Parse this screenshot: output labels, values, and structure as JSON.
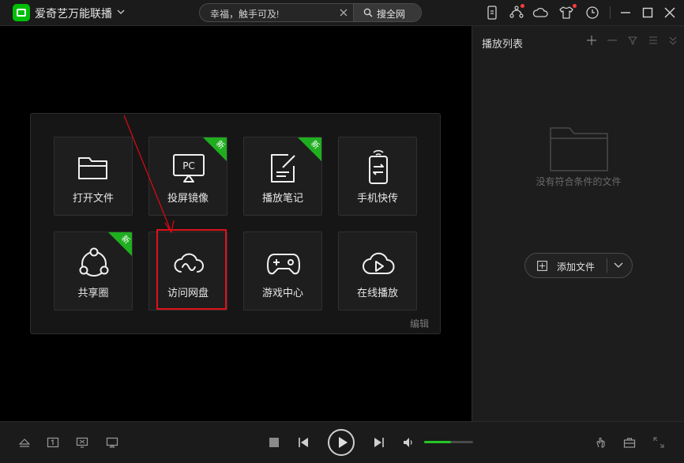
{
  "app": {
    "title": "爱奇艺万能联播"
  },
  "search": {
    "placeholder": "幸福，触手可及!",
    "button_label": "搜全网"
  },
  "playlist": {
    "title": "播放列表",
    "empty_text": "没有符合条件的文件",
    "add_button_label": "添加文件"
  },
  "home": {
    "tiles": [
      {
        "label": "打开文件",
        "icon": "folder-icon",
        "badge": ""
      },
      {
        "label": "投屏镜像",
        "icon": "screen-mirror-icon",
        "badge": "新"
      },
      {
        "label": "播放笔记",
        "icon": "note-icon",
        "badge": "新"
      },
      {
        "label": "手机快传",
        "icon": "phone-transfer-icon",
        "badge": ""
      },
      {
        "label": "共享圈",
        "icon": "share-circle-icon",
        "badge": "新"
      },
      {
        "label": "访问网盘",
        "icon": "cloud-drive-icon",
        "badge": ""
      },
      {
        "label": "游戏中心",
        "icon": "gamepad-icon",
        "badge": ""
      },
      {
        "label": "在线播放",
        "icon": "cloud-play-icon",
        "badge": ""
      }
    ],
    "edit_label": "编辑",
    "screen_mirror_text": "PC"
  },
  "player": {
    "volume": 0.55
  },
  "colors": {
    "accent": "#25c626",
    "highlight": "#e0101a",
    "badge": "#1fae1f"
  }
}
